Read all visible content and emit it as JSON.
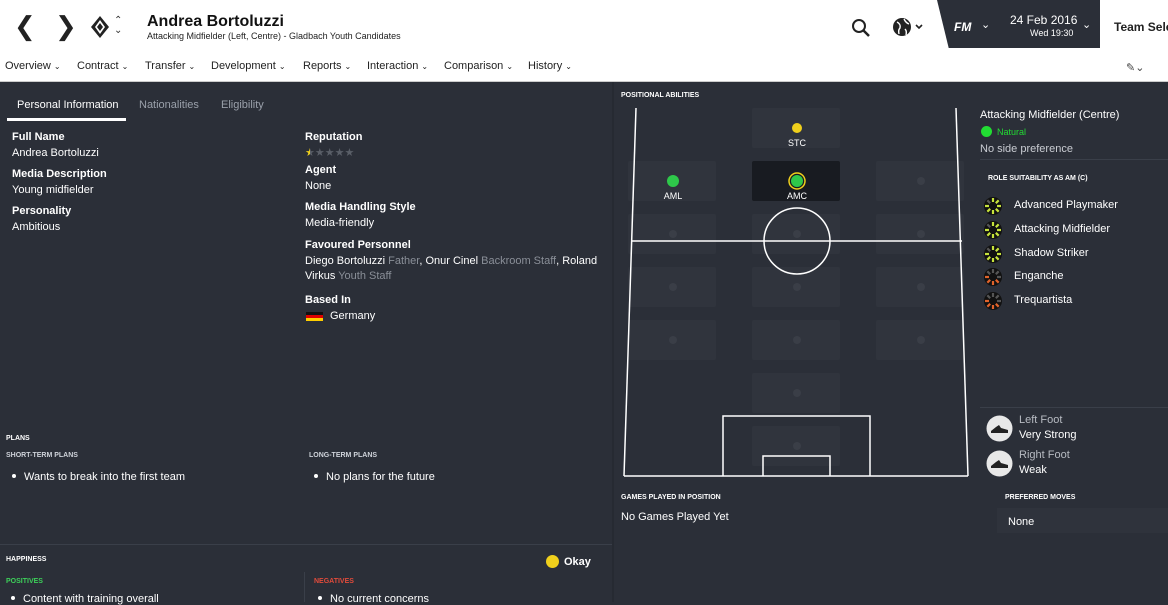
{
  "colors": {
    "accent_green": "#2ec84a",
    "natural_green": "#22dd33",
    "positives": "#3dd15a",
    "negatives": "#e24b3b",
    "okay_yellow": "#f0d01c",
    "background": "#2b2f38"
  },
  "header": {
    "back_icon": "chevron-left-icon",
    "forward_icon": "chevron-right-icon",
    "club_icon": "club-crest-icon",
    "player_name": "Andrea Bortoluzzi",
    "subtitle": "Attacking Midfielder (Left, Centre) - Gladbach Youth Candidates",
    "search_icon": "search-icon",
    "globe_icon": "globe-icon",
    "fm_label": "FM",
    "date": "24 Feb 2016",
    "time": "Wed 19:30",
    "team_select": "Team Sele"
  },
  "menu": [
    "Overview",
    "Contract",
    "Transfer",
    "Development",
    "Reports",
    "Interaction",
    "Comparison",
    "History"
  ],
  "tabs": [
    "Personal Information",
    "Nationalities",
    "Eligibility"
  ],
  "personal": {
    "full_name_label": "Full Name",
    "full_name": "Andrea Bortoluzzi",
    "media_desc_label": "Media Description",
    "media_desc": "Young midfielder",
    "personality_label": "Personality",
    "personality": "Ambitious",
    "reputation_label": "Reputation",
    "reputation_stars": 0.5,
    "reputation_max": 5,
    "agent_label": "Agent",
    "agent": "None",
    "media_style_label": "Media Handling Style",
    "media_style": "Media-friendly",
    "fav_label": "Favoured Personnel",
    "fav1_name": "Diego Bortoluzzi",
    "fav1_role": "Father",
    "fav2_name": "Onur Cinel",
    "fav2_role": "Backroom Staff",
    "fav3_name_a": "Roland",
    "fav3_name_b": "Virkus",
    "fav3_role": "Youth Staff",
    "based_label": "Based In",
    "based": "Germany"
  },
  "plans": {
    "title": "PLANS",
    "short_title": "SHORT-TERM PLANS",
    "short": "Wants to break into the first team",
    "long_title": "LONG-TERM PLANS",
    "long": "No plans for the future"
  },
  "happiness": {
    "title": "HAPPINESS",
    "status": "Okay",
    "positives_title": "POSITIVES",
    "positive1": "Content with training overall",
    "negatives_title": "NEGATIVES",
    "negative1": "No current concerns"
  },
  "positional": {
    "title": "POSITIONAL ABILITIES",
    "positions": [
      {
        "label": "STC",
        "rating": "accomplished",
        "color": "#f0d01c"
      },
      {
        "label": "AML",
        "rating": "natural",
        "color": "#2ec84a"
      },
      {
        "label": "AMC",
        "rating": "natural",
        "color": "#2ec84a"
      }
    ],
    "main_position": "Attacking Midfielder (Centre)",
    "rating_label": "Natural",
    "side": "No side preference",
    "role_title": "ROLE SUITABILITY AS AM (C)",
    "roles": [
      {
        "name": "Advanced Playmaker",
        "level": 4
      },
      {
        "name": "Attacking Midfielder",
        "level": 4
      },
      {
        "name": "Shadow Striker",
        "level": 4
      },
      {
        "name": "Enganche",
        "level": 2
      },
      {
        "name": "Trequartista",
        "level": 2
      }
    ]
  },
  "feet": {
    "left_label": "Left Foot",
    "left": "Very Strong",
    "right_label": "Right Foot",
    "right": "Weak"
  },
  "games": {
    "title": "GAMES PLAYED IN POSITION",
    "value": "No Games Played Yet"
  },
  "moves": {
    "title": "PREFERRED MOVES",
    "value": "None"
  }
}
